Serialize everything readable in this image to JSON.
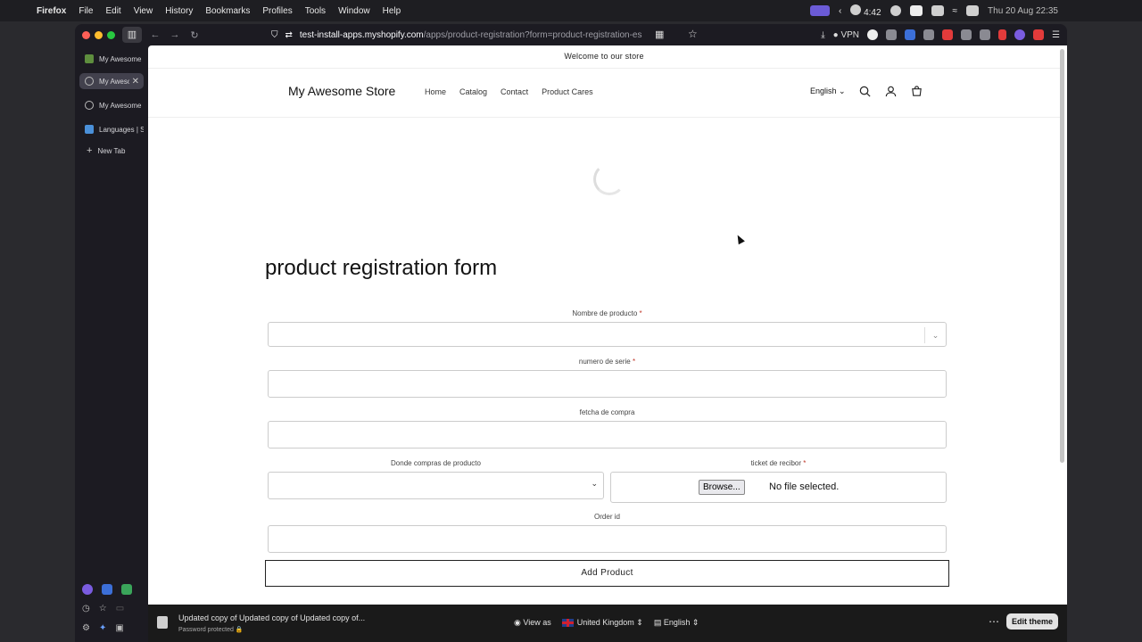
{
  "menubar": {
    "app_name": "Firefox",
    "items": [
      "File",
      "Edit",
      "View",
      "History",
      "Bookmarks",
      "Profiles",
      "Tools",
      "Window",
      "Help"
    ],
    "battery_time": "4:42",
    "datetime": "Thu 20 Aug  22:35"
  },
  "browser": {
    "url_host": "test-install-apps.myshopify.com",
    "url_path": "/apps/product-registration?form=product-registration-es",
    "vpn_label": "VPN",
    "tabs": [
      {
        "label": "My Awesome Store",
        "active": false
      },
      {
        "label": "My Awesome Store",
        "active": true
      },
      {
        "label": "My Awesome Store",
        "active": false
      },
      {
        "label": "Languages | Shopify",
        "active": false
      }
    ],
    "new_tab_label": "New Tab"
  },
  "store": {
    "announcement": "Welcome to our store",
    "name": "My Awesome Store",
    "nav": [
      "Home",
      "Catalog",
      "Contact",
      "Product Cares"
    ],
    "language": "English"
  },
  "form": {
    "title": "product registration form",
    "fields": {
      "product_name": {
        "label": "Nombre de producto",
        "required": "*"
      },
      "serial": {
        "label": "numero de serie",
        "required": "*"
      },
      "purchase_date": {
        "label": "fetcha de compra"
      },
      "where_bought": {
        "label": "Donde compras de producto"
      },
      "receipt": {
        "label": "ticket de recibor",
        "required": "*",
        "browse_label": "Browse...",
        "no_file": "No file selected."
      },
      "order_id": {
        "label": "Order id"
      }
    },
    "submit_label": "Add Product"
  },
  "preview_bar": {
    "theme_title": "Updated copy of Updated copy of Updated copy of...",
    "subtitle": "Password protected",
    "view_as": "View as",
    "country": "United Kingdom",
    "language": "English",
    "edit_theme": "Edit theme"
  }
}
